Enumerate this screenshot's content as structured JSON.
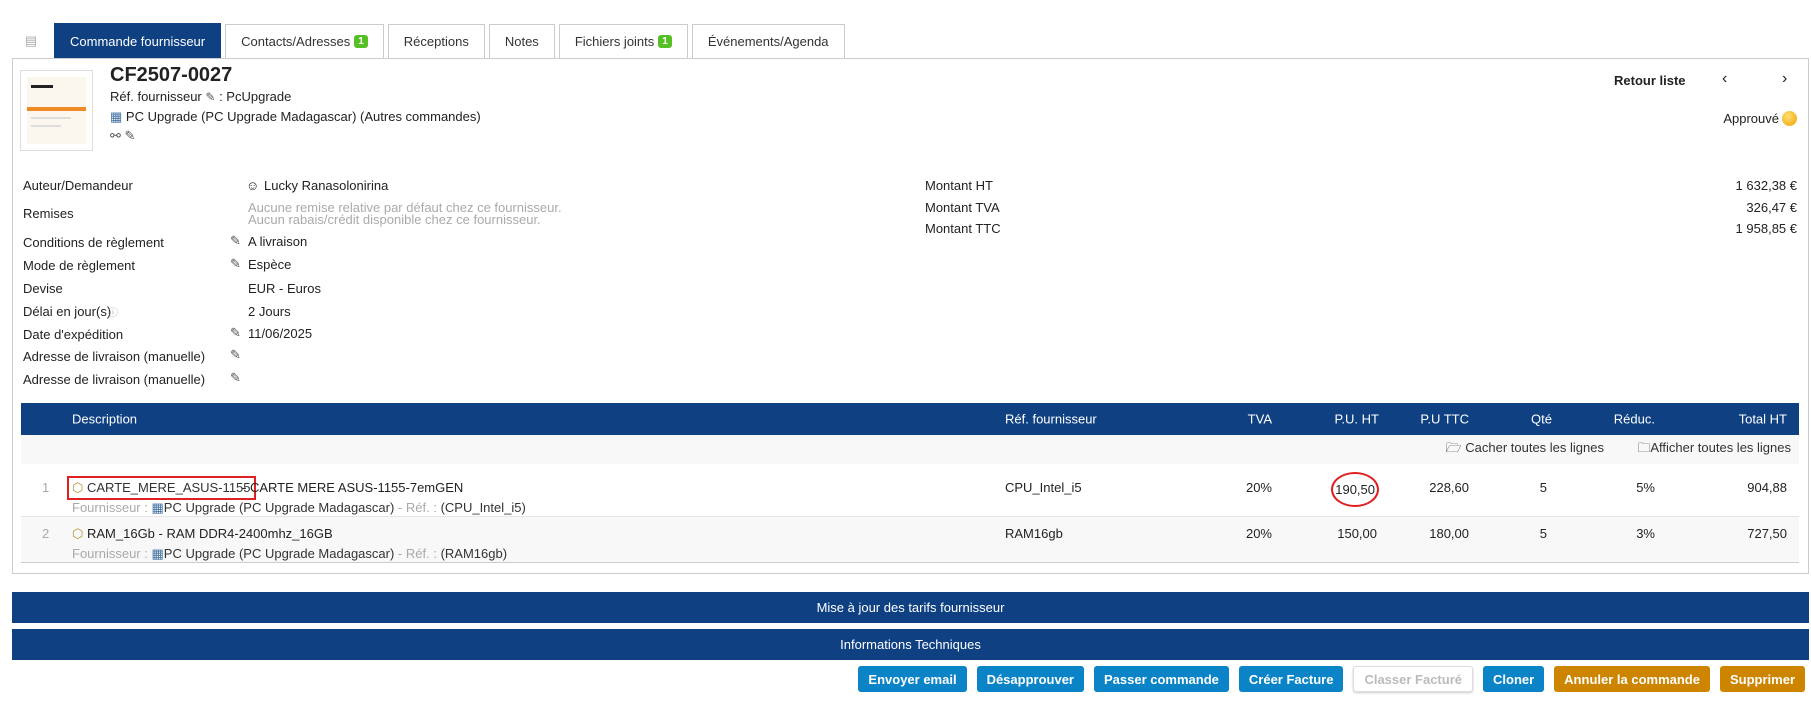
{
  "tabs": [
    {
      "label": "Commande fournisseur"
    },
    {
      "label": "Contacts/Adresses",
      "badge": "1"
    },
    {
      "label": "Réceptions"
    },
    {
      "label": "Notes"
    },
    {
      "label": "Fichiers joints",
      "badge": "1"
    },
    {
      "label": "Événements/Agenda"
    }
  ],
  "header": {
    "ref": "CF2507-0027",
    "ref_supplier_label": "Réf. fournisseur",
    "ref_supplier_value": ": PcUpgrade",
    "supplier": "PC Upgrade (PC Upgrade Madagascar)",
    "other_orders": "(Autres commandes)",
    "back_list": "Retour liste",
    "status": "Approuvé"
  },
  "fields": [
    {
      "label": "Auteur/Demandeur",
      "value": "Lucky Ranasolonirina"
    },
    {
      "label": "Remises",
      "value": "Aucune remise relative par défaut chez ce fournisseur.",
      "value2": "Aucun rabais/crédit disponible chez ce fournisseur."
    },
    {
      "label": "Conditions de règlement",
      "value": "A livraison"
    },
    {
      "label": "Mode de règlement",
      "value": "Espèce"
    },
    {
      "label": "Devise",
      "value": "EUR - Euros"
    },
    {
      "label": "Délai en jour(s)",
      "value": "2 Jours"
    },
    {
      "label": "Date d'expédition",
      "value": "11/06/2025"
    },
    {
      "label": "Adresse de livraison (manuelle)"
    },
    {
      "label": "Adresse de livraison (manuelle)"
    }
  ],
  "amounts": [
    {
      "label": "Montant HT",
      "value": "1 632,38 €"
    },
    {
      "label": "Montant TVA",
      "value": "326,47 €"
    },
    {
      "label": "Montant TTC",
      "value": "1 958,85 €"
    }
  ],
  "table": {
    "headers": {
      "desc": "Description",
      "ref": "Réf. fournisseur",
      "tva": "TVA",
      "pu_ht": "P.U. HT",
      "pu_ttc": "P.U TTC",
      "qty": "Qté",
      "reduc": "Réduc.",
      "total": "Total HT"
    },
    "hide_all": "Cacher toutes les lignes",
    "show_all": "Afficher toutes les lignes",
    "supplier_label": "Fournisseur :",
    "ref_label": "- Réf. :",
    "rows": [
      {
        "num": "1",
        "code": "CARTE_MERE_ASUS-1155",
        "label": "- CARTE MERE ASUS-1155-7emGEN",
        "supplier": "PC Upgrade (PC Upgrade Madagascar)",
        "sref": "(CPU_Intel_i5)",
        "ref": "CPU_Intel_i5",
        "tva": "20%",
        "pu_ht": "190,50",
        "pu_ttc": "228,60",
        "qty": "5",
        "reduc": "5%",
        "total": "904,88"
      },
      {
        "num": "2",
        "code": "RAM_16Gb",
        "label": "- RAM DDR4-2400mhz_16GB",
        "supplier": "PC Upgrade (PC Upgrade Madagascar)",
        "sref": "(RAM16gb)",
        "ref": "RAM16gb",
        "tva": "20%",
        "pu_ht": "150,00",
        "pu_ttc": "180,00",
        "qty": "5",
        "reduc": "3%",
        "total": "727,50"
      }
    ]
  },
  "sections": {
    "update_prices": "Mise à jour des tarifs fournisseur",
    "tech_info": "Informations Techniques"
  },
  "buttons": {
    "send_email": "Envoyer email",
    "disapprove": "Désapprouver",
    "place_order": "Passer commande",
    "create_invoice": "Créer Facture",
    "classify_billed": "Classer Facturé",
    "clone": "Cloner",
    "cancel_order": "Annuler la commande",
    "delete": "Supprimer"
  }
}
